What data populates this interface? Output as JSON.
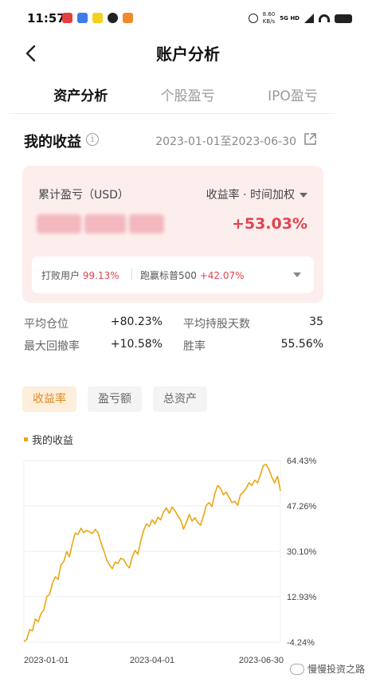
{
  "status": {
    "time": "11:57",
    "speed_value": "8.60",
    "speed_unit": "KB/s",
    "network": "5G HD"
  },
  "header": {
    "title": "账户分析"
  },
  "tabs": [
    {
      "label": "资产分析"
    },
    {
      "label": "个股盈亏"
    },
    {
      "label": "IPO盈亏"
    }
  ],
  "section": {
    "title": "我的收益",
    "date_range": "2023-01-01至2023-06-30"
  },
  "pnl": {
    "label": "累计盈亏（USD）",
    "metric_select": "收益率 · 时间加权",
    "return_value": "+53.03%",
    "beat_label": "打败用户",
    "beat_value": "99.13%",
    "sp_label": "跑赢标普500",
    "sp_value": "+42.07%"
  },
  "stats": {
    "avg_position_label": "平均仓位",
    "avg_position_value": "+80.23%",
    "avg_hold_label": "平均持股天数",
    "avg_hold_value": "35",
    "max_dd_label": "最大回撤率",
    "max_dd_value": "+10.58%",
    "win_rate_label": "胜率",
    "win_rate_value": "55.56%"
  },
  "chart_tabs": [
    {
      "label": "收益率"
    },
    {
      "label": "盈亏额"
    },
    {
      "label": "总资产"
    }
  ],
  "legend": "我的收益",
  "watermark": "慢慢投资之路",
  "colors": {
    "accent_red": "#e0454f",
    "line": "#e9a714",
    "tab_active": "#e28a1c"
  },
  "chart_data": {
    "type": "line",
    "title": "",
    "xlabel": "",
    "ylabel": "",
    "y_ticks": [
      "64.43%",
      "47.26%",
      "30.10%",
      "12.93%",
      "-4.24%"
    ],
    "x_ticks": [
      "2023-01-01",
      "2023-04-01",
      "2023-06-30"
    ],
    "ylim": [
      -4.24,
      64.43
    ],
    "x_range": [
      "2023-01-01",
      "2023-06-30"
    ],
    "grid": true,
    "series": [
      {
        "name": "我的收益",
        "points": [
          [
            "2023-01-01",
            -4.0
          ],
          [
            "2023-01-03",
            -3.2
          ],
          [
            "2023-01-05",
            0.5
          ],
          [
            "2023-01-07",
            0.0
          ],
          [
            "2023-01-09",
            4.5
          ],
          [
            "2023-01-11",
            3.5
          ],
          [
            "2023-01-13",
            6.5
          ],
          [
            "2023-01-15",
            8.0
          ],
          [
            "2023-01-17",
            13.0
          ],
          [
            "2023-01-19",
            13.8
          ],
          [
            "2023-01-21",
            18.0
          ],
          [
            "2023-01-23",
            20.5
          ],
          [
            "2023-01-25",
            19.5
          ],
          [
            "2023-01-27",
            25.0
          ],
          [
            "2023-01-29",
            26.2
          ],
          [
            "2023-01-31",
            30.0
          ],
          [
            "2023-02-02",
            28.0
          ],
          [
            "2023-02-04",
            33.0
          ],
          [
            "2023-02-06",
            37.0
          ],
          [
            "2023-02-08",
            36.5
          ],
          [
            "2023-02-10",
            38.8
          ],
          [
            "2023-02-12",
            37.2
          ],
          [
            "2023-02-14",
            38.0
          ],
          [
            "2023-02-16",
            37.5
          ],
          [
            "2023-02-18",
            36.8
          ],
          [
            "2023-02-20",
            38.4
          ],
          [
            "2023-02-22",
            37.2
          ],
          [
            "2023-02-24",
            33.5
          ],
          [
            "2023-02-26",
            30.5
          ],
          [
            "2023-02-28",
            27.0
          ],
          [
            "2023-03-02",
            25.0
          ],
          [
            "2023-03-04",
            23.5
          ],
          [
            "2023-03-06",
            26.0
          ],
          [
            "2023-03-08",
            25.5
          ],
          [
            "2023-03-10",
            27.5
          ],
          [
            "2023-03-12",
            27.0
          ],
          [
            "2023-03-14",
            25.0
          ],
          [
            "2023-03-16",
            23.8
          ],
          [
            "2023-03-18",
            28.0
          ],
          [
            "2023-03-20",
            30.5
          ],
          [
            "2023-03-22",
            29.0
          ],
          [
            "2023-03-24",
            34.0
          ],
          [
            "2023-03-26",
            38.0
          ],
          [
            "2023-03-28",
            40.5
          ],
          [
            "2023-03-30",
            39.5
          ],
          [
            "2023-04-01",
            42.0
          ],
          [
            "2023-04-03",
            40.5
          ],
          [
            "2023-04-05",
            43.0
          ],
          [
            "2023-04-07",
            42.0
          ],
          [
            "2023-04-09",
            45.0
          ],
          [
            "2023-04-11",
            46.5
          ],
          [
            "2023-04-13",
            44.5
          ],
          [
            "2023-04-15",
            46.8
          ],
          [
            "2023-04-17",
            45.5
          ],
          [
            "2023-04-19",
            43.5
          ],
          [
            "2023-04-21",
            42.0
          ],
          [
            "2023-04-23",
            38.5
          ],
          [
            "2023-04-25",
            41.0
          ],
          [
            "2023-04-27",
            44.0
          ],
          [
            "2023-04-29",
            41.5
          ],
          [
            "2023-05-01",
            42.8
          ],
          [
            "2023-05-03",
            41.0
          ],
          [
            "2023-05-05",
            40.0
          ],
          [
            "2023-05-07",
            43.5
          ],
          [
            "2023-05-09",
            47.5
          ],
          [
            "2023-05-11",
            48.5
          ],
          [
            "2023-05-13",
            47.0
          ],
          [
            "2023-05-15",
            52.0
          ],
          [
            "2023-05-17",
            55.0
          ],
          [
            "2023-05-19",
            53.8
          ],
          [
            "2023-05-21",
            51.5
          ],
          [
            "2023-05-23",
            52.5
          ],
          [
            "2023-05-25",
            50.5
          ],
          [
            "2023-05-27",
            48.5
          ],
          [
            "2023-05-29",
            49.0
          ],
          [
            "2023-05-31",
            47.5
          ],
          [
            "2023-06-02",
            51.5
          ],
          [
            "2023-06-04",
            52.5
          ],
          [
            "2023-06-06",
            54.0
          ],
          [
            "2023-06-08",
            56.0
          ],
          [
            "2023-06-10",
            55.0
          ],
          [
            "2023-06-12",
            57.0
          ],
          [
            "2023-06-14",
            56.0
          ],
          [
            "2023-06-16",
            59.0
          ],
          [
            "2023-06-18",
            62.5
          ],
          [
            "2023-06-20",
            63.0
          ],
          [
            "2023-06-22",
            61.0
          ],
          [
            "2023-06-24",
            58.0
          ],
          [
            "2023-06-26",
            56.0
          ],
          [
            "2023-06-28",
            58.5
          ],
          [
            "2023-06-30",
            53.0
          ]
        ]
      }
    ]
  }
}
